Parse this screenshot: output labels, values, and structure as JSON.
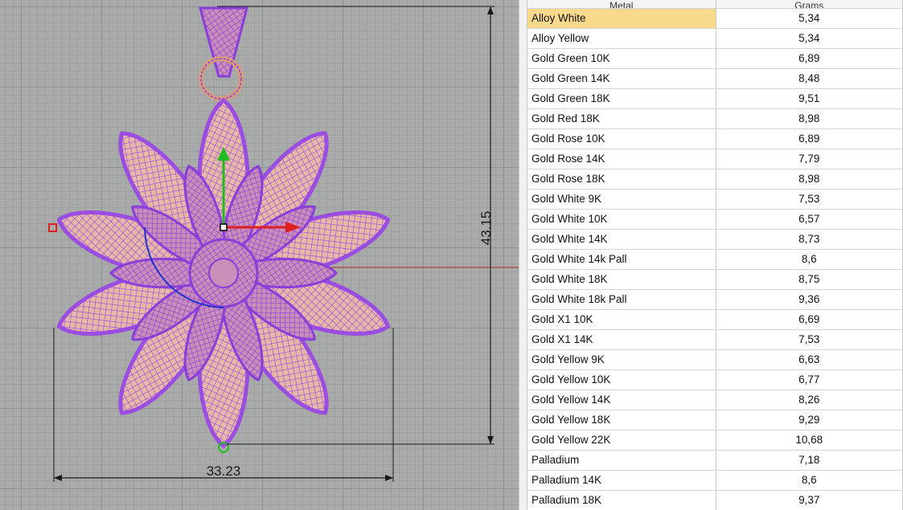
{
  "viewport": {
    "dimension_height": "43.15",
    "dimension_width": "33.23",
    "colors": {
      "background": "#a8aba9",
      "wireframe": "#9a4de0",
      "surface": "#e6b9a6",
      "dimension_line": "#1a1a1a",
      "axis_x": "#e02020",
      "axis_y": "#22bb22"
    }
  },
  "table": {
    "headers": [
      "Metal",
      "Grams"
    ],
    "selected_index": 0,
    "rows": [
      {
        "metal": "Alloy White",
        "grams": "5,34"
      },
      {
        "metal": "Alloy Yellow",
        "grams": "5,34"
      },
      {
        "metal": "Gold Green 10K",
        "grams": "6,89"
      },
      {
        "metal": "Gold Green 14K",
        "grams": "8,48"
      },
      {
        "metal": "Gold Green 18K",
        "grams": "9,51"
      },
      {
        "metal": "Gold Red 18K",
        "grams": "8,98"
      },
      {
        "metal": "Gold Rose 10K",
        "grams": "6,89"
      },
      {
        "metal": "Gold Rose 14K",
        "grams": "7,79"
      },
      {
        "metal": "Gold Rose 18K",
        "grams": "8,98"
      },
      {
        "metal": "Gold White 9K",
        "grams": "7,53"
      },
      {
        "metal": "Gold White 10K",
        "grams": "6,57"
      },
      {
        "metal": "Gold White 14K",
        "grams": "8,73"
      },
      {
        "metal": "Gold White 14k Pall",
        "grams": "8,6"
      },
      {
        "metal": "Gold White 18K",
        "grams": "8,75"
      },
      {
        "metal": "Gold White 18k Pall",
        "grams": "9,36"
      },
      {
        "metal": "Gold X1 10K",
        "grams": "6,69"
      },
      {
        "metal": "Gold X1 14K",
        "grams": "7,53"
      },
      {
        "metal": "Gold Yellow 9K",
        "grams": "6,63"
      },
      {
        "metal": "Gold Yellow 10K",
        "grams": "6,77"
      },
      {
        "metal": "Gold Yellow 14K",
        "grams": "8,26"
      },
      {
        "metal": "Gold Yellow 18K",
        "grams": "9,29"
      },
      {
        "metal": "Gold Yellow 22K",
        "grams": "10,68"
      },
      {
        "metal": "Palladium",
        "grams": "7,18"
      },
      {
        "metal": "Palladium 14K",
        "grams": "8,6"
      },
      {
        "metal": "Palladium 18K",
        "grams": "9,37"
      }
    ]
  }
}
